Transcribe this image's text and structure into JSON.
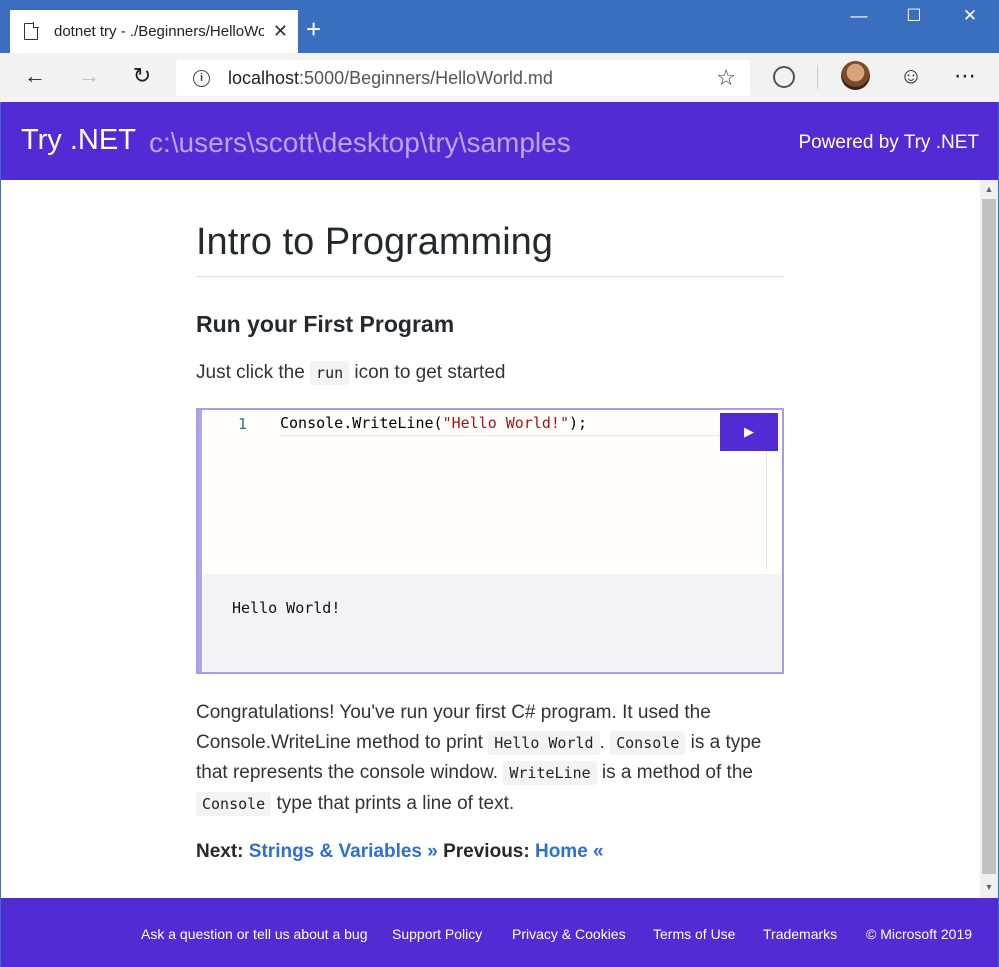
{
  "browser": {
    "tab_title": "dotnet try - ./Beginners/HelloWo",
    "tab_close": "✕",
    "new_tab": "+",
    "window_min": "—",
    "window_max": "☐",
    "window_close": "✕",
    "url_host": "localhost",
    "url_rest": ":5000/Beginners/HelloWorld.md",
    "icons": [
      "page-icon",
      "close-icon",
      "plus-icon",
      "back-icon",
      "forward-icon",
      "refresh-icon",
      "info-icon",
      "star-icon",
      "extension-icon",
      "avatar",
      "smiley-icon",
      "more-icon"
    ]
  },
  "header": {
    "brand": "Try .NET",
    "path": "c:\\users\\scott\\desktop\\try\\samples",
    "powered": "Powered by Try .NET"
  },
  "main": {
    "title": "Intro to Programming",
    "subtitle": "Run your First Program",
    "intro_before": "Just click the ",
    "intro_code": "run",
    "intro_after": " icon to get started",
    "editor": {
      "line_number": "1",
      "code_prefix": "Console.WriteLine(",
      "code_string": "\"Hello World!\"",
      "code_suffix": ");",
      "run_label": "▶",
      "output": "Hello World!"
    },
    "para": {
      "t1": "Congratulations! You've run your first C# program. It used the Console.WriteLine method to print ",
      "c1": "Hello World",
      "t2": ". ",
      "c2": "Console",
      "t3": " is a type that represents the console window. ",
      "c3": "WriteLine",
      "t4": " is a method of the ",
      "c4": "Console",
      "t5": " type that prints a line of text."
    },
    "next_label": "Next: ",
    "next_link": "Strings & Variables »",
    "prev_label": " Previous: ",
    "prev_link": "Home «"
  },
  "footer": {
    "links": [
      "Ask a question or tell us about a bug",
      "Support Policy",
      "Privacy & Cookies",
      "Terms of Use",
      "Trademarks",
      "© Microsoft 2019"
    ]
  },
  "colors": {
    "brand_purple": "#512bd4",
    "titlebar_blue": "#3a6fbf",
    "link_blue": "#2f6fd0"
  }
}
